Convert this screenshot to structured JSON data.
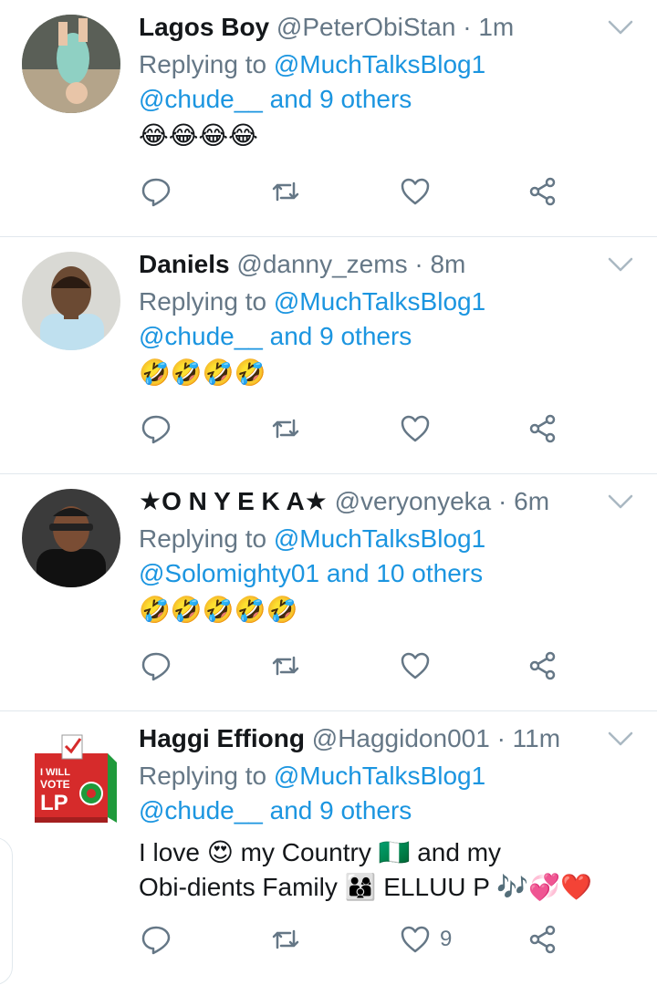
{
  "tweets": [
    {
      "name": "Lagos Boy",
      "handle": "@PeterObiStan",
      "time": "1m",
      "replying_to_label": "Replying to",
      "replying_to_primary": "@MuchTalksBlog1",
      "replying_to_secondary": "@chude__ and 9 others",
      "content": "😂😂😂😂",
      "like_count": ""
    },
    {
      "name": "Daniels",
      "handle": "@danny_zems",
      "time": "8m",
      "replying_to_label": "Replying to",
      "replying_to_primary": "@MuchTalksBlog1",
      "replying_to_secondary": "@chude__ and 9 others",
      "content": "🤣🤣🤣🤣",
      "like_count": ""
    },
    {
      "name": "★O N Y E K A★",
      "handle": "@veryonyeka",
      "time": "6m",
      "replying_to_label": "Replying to",
      "replying_to_primary": "@MuchTalksBlog1",
      "replying_to_secondary": "@Solomighty01 and 10 others",
      "content": "🤣🤣🤣🤣🤣",
      "like_count": ""
    },
    {
      "name": "Haggi Effiong",
      "handle": "@Haggidon001",
      "time": "11m",
      "replying_to_label": "Replying to",
      "replying_to_primary": "@MuchTalksBlog1",
      "replying_to_secondary": "@chude__ and 9 others",
      "content_line1": "I love 😍 my Country 🇳🇬 and my",
      "content_line2": "Obi-dients Family 👨‍👩‍👦 ELLUU P 🎶💞❤️",
      "like_count": "9"
    }
  ],
  "separator": "·",
  "avatar_logo_text": [
    "I WILL",
    "VOTE",
    "LP"
  ],
  "colors": {
    "text_primary": "#14171a",
    "text_secondary": "#657786",
    "link": "#1b95e0",
    "divider": "#e1e8ed"
  },
  "icons": [
    "reply-icon",
    "retweet-icon",
    "like-icon",
    "share-icon",
    "chevron-down-icon"
  ]
}
